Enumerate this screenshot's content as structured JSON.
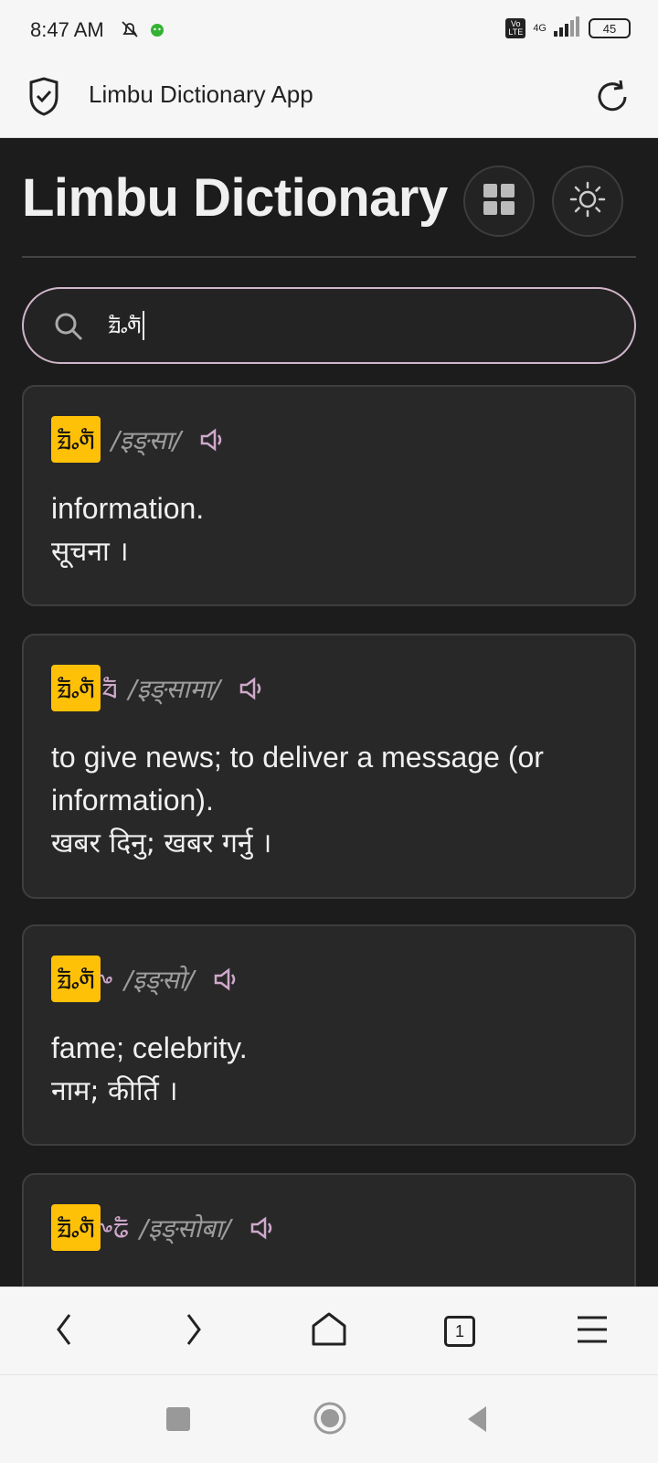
{
  "status": {
    "time": "8:47 AM",
    "network": "4G",
    "volte": "Vo LTE",
    "battery": "45"
  },
  "browser": {
    "title": "Limbu Dictionary App",
    "tab_count": "1"
  },
  "header": {
    "title": "Limbu Dictionary"
  },
  "search": {
    "query": "ᤀᤠᤱᤛᤠ"
  },
  "entries": [
    {
      "word": "ᤀᤠᤱᤛᤠ",
      "suffix": "",
      "pron": "/इङ्सा/",
      "def_en": "information.",
      "def_np": "सूचना ।"
    },
    {
      "word": "ᤀᤠᤱᤛᤠ",
      "suffix": "ᤔᤠ",
      "pron": "/इङ्सामा/",
      "def_en": "to give news; to deliver a message (or information).",
      "def_np": "खबर दिनु; खबर गर्नु ।"
    },
    {
      "word": "ᤀᤠᤱᤛᤠ",
      "suffix": "ᤴ",
      "pron": "/इङ्सो/",
      "def_en": "fame; celebrity.",
      "def_np": "नाम; कीर्ति ।"
    },
    {
      "word": "ᤀᤠᤱᤛᤠ",
      "suffix": "ᤴᤒᤠ",
      "pron": "/इङ्सोबा/"
    }
  ]
}
